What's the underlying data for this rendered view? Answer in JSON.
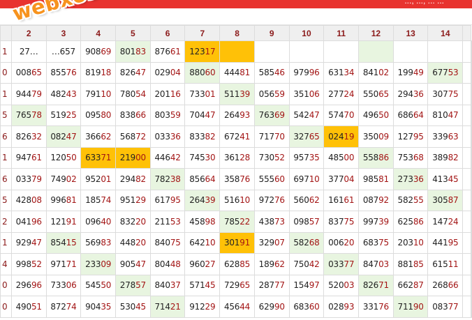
{
  "page": {
    "topbar_text": "..., ..., ... ...",
    "watermark": "webxoso.net"
  },
  "header": [
    "",
    "2",
    "3",
    "4",
    "5",
    "6",
    "7",
    "8",
    "9",
    "10",
    "11",
    "12",
    "13",
    "14",
    ""
  ],
  "rows": [
    {
      "label": "1",
      "cells": [
        "27…",
        "…657",
        "90869",
        "80183",
        "87661",
        "12317",
        "",
        "",
        "",
        "",
        "",
        "",
        "",
        ""
      ]
    },
    {
      "label": "0",
      "cells": [
        "00865",
        "85576",
        "81918",
        "82647",
        "02904",
        "88060",
        "44481",
        "58546",
        "97996",
        "63134",
        "84102",
        "19949",
        "67753",
        ""
      ]
    },
    {
      "label": "1",
      "cells": [
        "94479",
        "48243",
        "79110",
        "78054",
        "20116",
        "73301",
        "51139",
        "05659",
        "35106",
        "27724",
        "55065",
        "29436",
        "30775",
        ""
      ]
    },
    {
      "label": "5",
      "cells": [
        "76578",
        "51925",
        "09580",
        "83866",
        "80359",
        "70447",
        "26493",
        "76369",
        "54247",
        "57470",
        "49650",
        "68664",
        "81047",
        ""
      ]
    },
    {
      "label": "6",
      "cells": [
        "82632",
        "08247",
        "36662",
        "56872",
        "03336",
        "83382",
        "67241",
        "71770",
        "32765",
        "02419",
        "35009",
        "12795",
        "33963",
        ""
      ]
    },
    {
      "label": "1",
      "cells": [
        "94761",
        "12050",
        "63371",
        "21900",
        "44642",
        "74530",
        "36128",
        "73052",
        "95735",
        "48500",
        "55886",
        "75368",
        "38982",
        ""
      ]
    },
    {
      "label": "6",
      "cells": [
        "03379",
        "74902",
        "95201",
        "29482",
        "78238",
        "85664",
        "35876",
        "55560",
        "69710",
        "37704",
        "98581",
        "27336",
        "41345",
        ""
      ]
    },
    {
      "label": "5",
      "cells": [
        "42808",
        "99681",
        "18574",
        "95129",
        "61795",
        "26439",
        "51610",
        "97276",
        "56062",
        "16161",
        "08792",
        "58255",
        "30587",
        ""
      ]
    },
    {
      "label": "2",
      "cells": [
        "04196",
        "12191",
        "09640",
        "83220",
        "21153",
        "45898",
        "78522",
        "43873",
        "09857",
        "83775",
        "99739",
        "62586",
        "14724",
        ""
      ]
    },
    {
      "label": "1",
      "cells": [
        "92947",
        "85415",
        "56983",
        "44820",
        "84075",
        "64210",
        "30191",
        "32907",
        "58268",
        "00620",
        "68375",
        "20310",
        "44195",
        ""
      ]
    },
    {
      "label": "4",
      "cells": [
        "99852",
        "97171",
        "23309",
        "90547",
        "80448",
        "96027",
        "62885",
        "18962",
        "75042",
        "03377",
        "84703",
        "88185",
        "61511",
        ""
      ]
    },
    {
      "label": "0",
      "cells": [
        "29696",
        "73306",
        "54550",
        "27857",
        "84037",
        "57145",
        "72965",
        "28777",
        "15497",
        "52003",
        "82671",
        "66287",
        "26866",
        ""
      ]
    },
    {
      "label": "0",
      "cells": [
        "49051",
        "87274",
        "90435",
        "53045",
        "71421",
        "91229",
        "45644",
        "62990",
        "68360",
        "02893",
        "33176",
        "71190",
        "08377",
        ""
      ]
    }
  ],
  "highlights": {
    "green": [
      [
        0,
        3
      ],
      [
        0,
        10
      ],
      [
        1,
        5
      ],
      [
        1,
        12
      ],
      [
        2,
        6
      ],
      [
        3,
        0
      ],
      [
        3,
        7
      ],
      [
        4,
        1
      ],
      [
        4,
        8
      ],
      [
        5,
        10
      ],
      [
        6,
        4
      ],
      [
        6,
        11
      ],
      [
        7,
        5
      ],
      [
        7,
        12
      ],
      [
        8,
        6
      ],
      [
        9,
        1
      ],
      [
        9,
        8
      ],
      [
        10,
        2
      ],
      [
        10,
        9
      ],
      [
        11,
        3
      ],
      [
        11,
        10
      ],
      [
        12,
        4
      ],
      [
        12,
        11
      ]
    ],
    "gold": [
      [
        0,
        5
      ],
      [
        0,
        6
      ],
      [
        4,
        9
      ],
      [
        5,
        2
      ],
      [
        5,
        3
      ],
      [
        9,
        6
      ]
    ],
    "gold_color": "#ffc107",
    "green_color": "#e8f5e0",
    "header_color": "#8b1a1a",
    "accent_color": "#e8332f"
  }
}
